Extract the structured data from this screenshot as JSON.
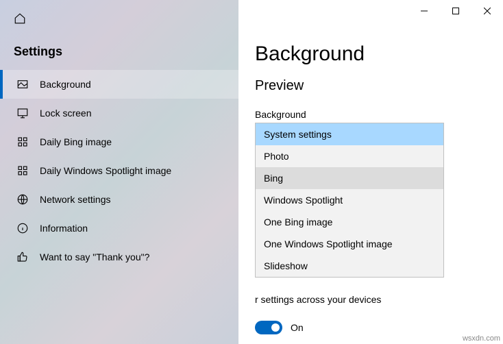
{
  "sidebar": {
    "title": "Settings",
    "items": [
      {
        "label": "Background"
      },
      {
        "label": "Lock screen"
      },
      {
        "label": "Daily Bing image"
      },
      {
        "label": "Daily Windows Spotlight image"
      },
      {
        "label": "Network settings"
      },
      {
        "label": "Information"
      },
      {
        "label": "Want to say \"Thank you\"?"
      }
    ]
  },
  "page": {
    "title": "Background",
    "section": "Preview",
    "field_label": "Background",
    "behind_text": "r settings across your devices",
    "toggle_label": "On"
  },
  "dropdown": {
    "options": [
      "System settings",
      "Photo",
      "Bing",
      "Windows Spotlight",
      "One Bing image",
      "One Windows Spotlight image",
      "Slideshow"
    ],
    "selected_index": 0,
    "hover_index": 2
  },
  "watermark": "wsxdn.com"
}
